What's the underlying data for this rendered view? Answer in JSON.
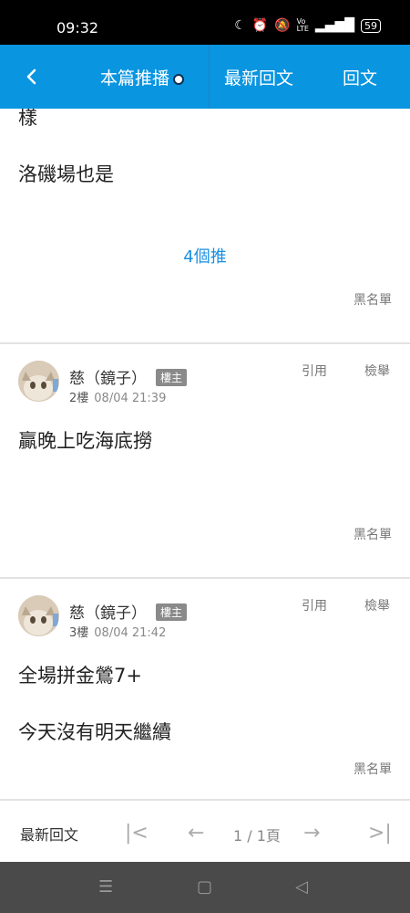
{
  "status_bar": {
    "time": "09:32",
    "battery": "59",
    "icons": [
      "moon-icon",
      "alarm-icon",
      "mute-icon",
      "volte-icon",
      "5g-signal-icon"
    ]
  },
  "header": {
    "tab_push": "本篇推播",
    "tab_latest": "最新回文",
    "tab_reply": "回文"
  },
  "posts": [
    {
      "lines": [
        "樣",
        "洛磯場也是"
      ],
      "push_count": "4個推",
      "blacklist": "黑名單"
    },
    {
      "author": "慈（鏡子）",
      "badge": "樓主",
      "floor": "2樓",
      "date": "08/04 21:39",
      "quote": "引用",
      "report": "檢舉",
      "lines": [
        "贏晚上吃海底撈"
      ],
      "blacklist": "黑名單"
    },
    {
      "author": "慈（鏡子）",
      "badge": "樓主",
      "floor": "3樓",
      "date": "08/04 21:42",
      "quote": "引用",
      "report": "檢舉",
      "lines": [
        "全場拼金鶯7+",
        "今天沒有明天繼續"
      ],
      "blacklist": "黑名單"
    }
  ],
  "pager": {
    "latest": "最新回文",
    "page": "1 / 1頁"
  },
  "colors": {
    "accent": "#0a95e0",
    "push_link": "#1a8ee0",
    "badge": "#8a8a8a"
  }
}
